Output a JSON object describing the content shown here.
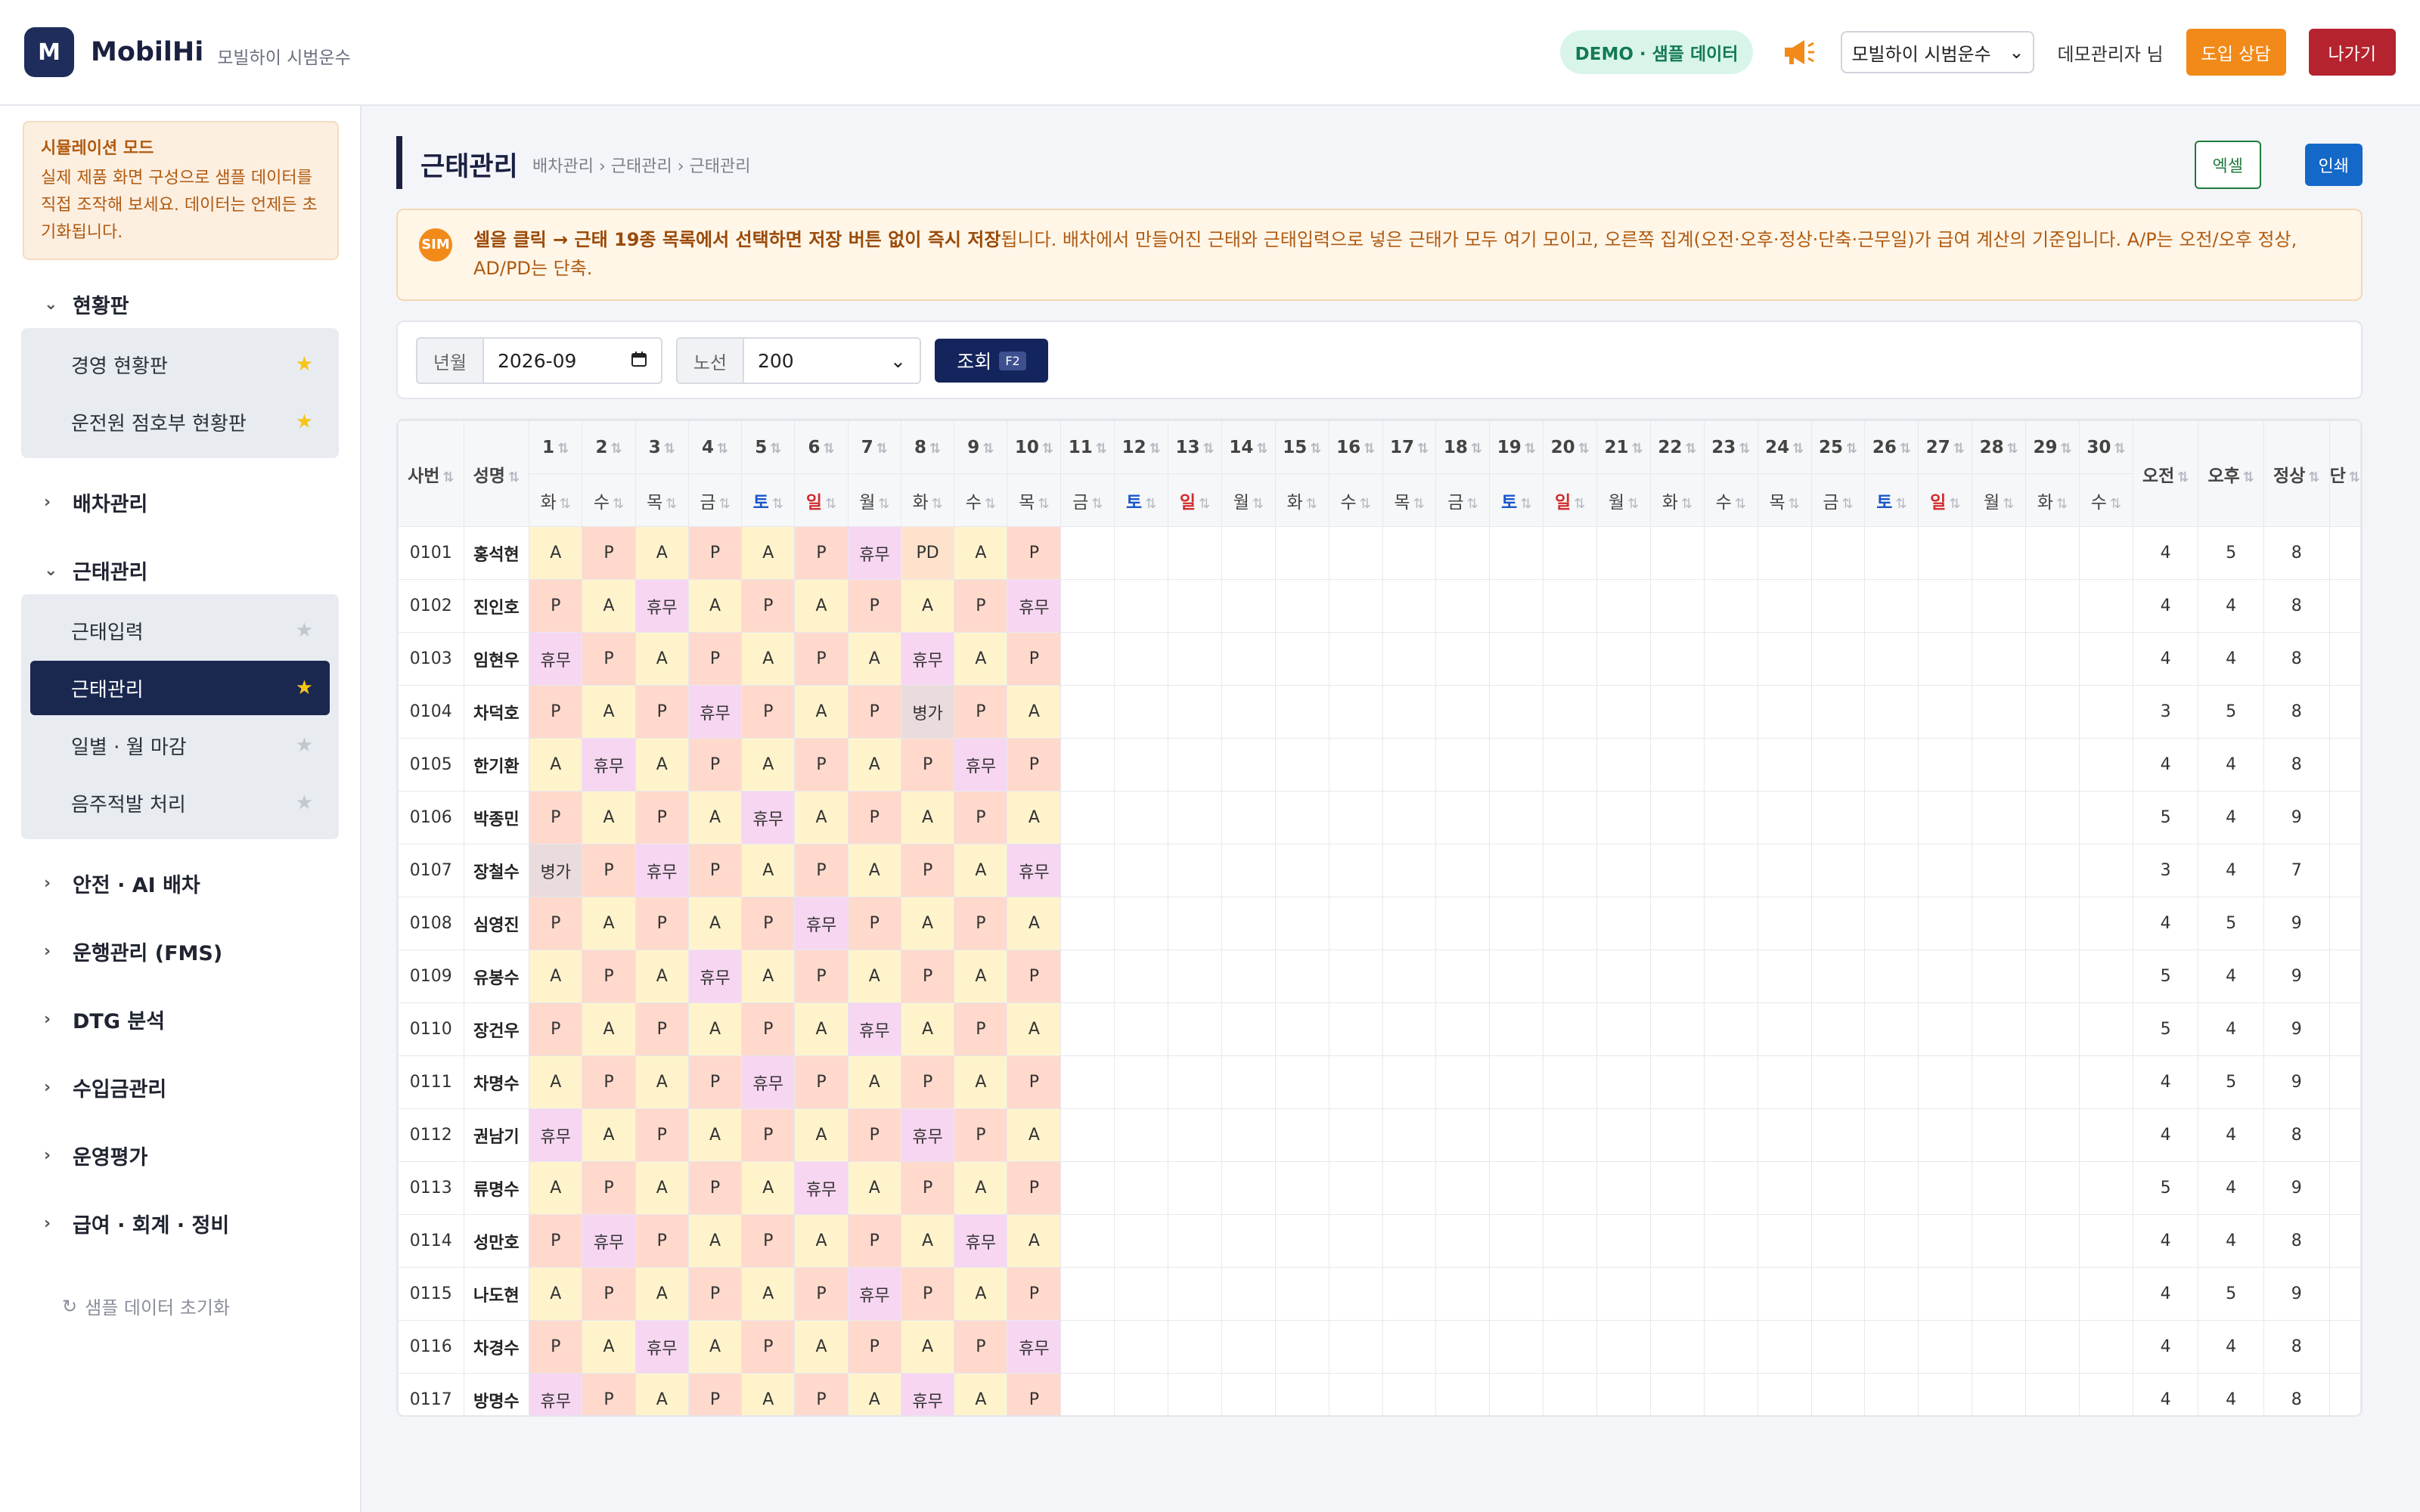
{
  "header": {
    "logo_letter": "M",
    "brand": "MobilHi",
    "brand_sub": "모빌하이 시범운수",
    "demo_badge": "DEMO · 샘플 데이터",
    "org_selected": "모빌하이 시범운수",
    "user": "데모관리자 님",
    "consult_label": "도입 상담",
    "exit_label": "나가기",
    "megaphone_color": "#f28a1a"
  },
  "sidebar": {
    "sim_title": "시뮬레이션 모드",
    "sim_text": "실제 제품 화면 구성으로 샘플 데이터를 직접 조작해 보세요. 데이터는 언제든 초기화됩니다.",
    "groups": [
      {
        "label": "현황판",
        "expanded": true,
        "items": [
          {
            "label": "경영 현황판",
            "starred": true,
            "active": false
          },
          {
            "label": "운전원 점호부 현황판",
            "starred": true,
            "active": false
          }
        ]
      },
      {
        "label": "배차관리",
        "expanded": false,
        "items": []
      },
      {
        "label": "근태관리",
        "expanded": true,
        "items": [
          {
            "label": "근태입력",
            "starred": false,
            "active": false
          },
          {
            "label": "근태관리",
            "starred": true,
            "active": true
          },
          {
            "label": "일별 · 월 마감",
            "starred": false,
            "active": false
          },
          {
            "label": "음주적발 처리",
            "starred": false,
            "active": false
          }
        ]
      },
      {
        "label": "안전 · AI 배차",
        "expanded": false,
        "items": []
      },
      {
        "label": "운행관리 (FMS)",
        "expanded": false,
        "items": []
      },
      {
        "label": "DTG 분석",
        "expanded": false,
        "items": []
      },
      {
        "label": "수입금관리",
        "expanded": false,
        "items": []
      },
      {
        "label": "운영평가",
        "expanded": false,
        "items": []
      },
      {
        "label": "급여 · 회계 · 정비",
        "expanded": false,
        "items": []
      }
    ],
    "reset_label": "샘플 데이터 초기화"
  },
  "page": {
    "title": "근태관리",
    "breadcrumb": "배차관리 › 근태관리 › 근태관리",
    "excel_label": "엑셀",
    "print_label": "인쇄"
  },
  "notice": {
    "icon": "SIM",
    "bold": "셀을 클릭 → 근태 19종 목록에서 선택하면 저장 버튼 없이 즉시 저장",
    "rest": "됩니다. 배차에서 만들어진 근태와 근태입력으로 넣은 근태가 모두 여기 모이고, 오른쪽 집계(오전·오후·정상·단축·근무일)가 급여 계산의 기준입니다. A/P는 오전/오후 정상, AD/PD는 단축."
  },
  "filter": {
    "month_label": "년월",
    "month_value": "2026-09",
    "route_label": "노선",
    "route_value": "200",
    "query_label": "조회",
    "query_key": "F2"
  },
  "grid": {
    "col_emp": "사번",
    "col_name": "성명",
    "days": [
      "1",
      "2",
      "3",
      "4",
      "5",
      "6",
      "7",
      "8",
      "9",
      "10",
      "11",
      "12",
      "13",
      "14",
      "15",
      "16",
      "17",
      "18",
      "19",
      "20",
      "21",
      "22",
      "23",
      "24",
      "25",
      "26",
      "27",
      "28",
      "29",
      "30"
    ],
    "weekdays": [
      "화",
      "수",
      "목",
      "금",
      "토",
      "일",
      "월",
      "화",
      "수",
      "목",
      "금",
      "토",
      "일",
      "월",
      "화",
      "수",
      "목",
      "금",
      "토",
      "일",
      "월",
      "화",
      "수",
      "목",
      "금",
      "토",
      "일",
      "월",
      "화",
      "수"
    ],
    "sum_cols": [
      "오전",
      "오후",
      "정상",
      "단"
    ],
    "rows": [
      {
        "emp": "0101",
        "name": "홍석현",
        "cells": [
          "A",
          "P",
          "A",
          "P",
          "A",
          "P",
          "휴무",
          "PD",
          "A",
          "P"
        ],
        "am": "4",
        "pm": "5",
        "normal": "8"
      },
      {
        "emp": "0102",
        "name": "진인호",
        "cells": [
          "P",
          "A",
          "휴무",
          "A",
          "P",
          "A",
          "P",
          "A",
          "P",
          "휴무"
        ],
        "am": "4",
        "pm": "4",
        "normal": "8"
      },
      {
        "emp": "0103",
        "name": "임현우",
        "cells": [
          "휴무",
          "P",
          "A",
          "P",
          "A",
          "P",
          "A",
          "휴무",
          "A",
          "P"
        ],
        "am": "4",
        "pm": "4",
        "normal": "8"
      },
      {
        "emp": "0104",
        "name": "차덕호",
        "cells": [
          "P",
          "A",
          "P",
          "휴무",
          "P",
          "A",
          "P",
          "병가",
          "P",
          "A"
        ],
        "am": "3",
        "pm": "5",
        "normal": "8"
      },
      {
        "emp": "0105",
        "name": "한기환",
        "cells": [
          "A",
          "휴무",
          "A",
          "P",
          "A",
          "P",
          "A",
          "P",
          "휴무",
          "P"
        ],
        "am": "4",
        "pm": "4",
        "normal": "8"
      },
      {
        "emp": "0106",
        "name": "박종민",
        "cells": [
          "P",
          "A",
          "P",
          "A",
          "휴무",
          "A",
          "P",
          "A",
          "P",
          "A"
        ],
        "am": "5",
        "pm": "4",
        "normal": "9"
      },
      {
        "emp": "0107",
        "name": "장철수",
        "cells": [
          "병가",
          "P",
          "휴무",
          "P",
          "A",
          "P",
          "A",
          "P",
          "A",
          "휴무"
        ],
        "am": "3",
        "pm": "4",
        "normal": "7"
      },
      {
        "emp": "0108",
        "name": "심영진",
        "cells": [
          "P",
          "A",
          "P",
          "A",
          "P",
          "휴무",
          "P",
          "A",
          "P",
          "A"
        ],
        "am": "4",
        "pm": "5",
        "normal": "9"
      },
      {
        "emp": "0109",
        "name": "유봉수",
        "cells": [
          "A",
          "P",
          "A",
          "휴무",
          "A",
          "P",
          "A",
          "P",
          "A",
          "P"
        ],
        "am": "5",
        "pm": "4",
        "normal": "9"
      },
      {
        "emp": "0110",
        "name": "장건우",
        "cells": [
          "P",
          "A",
          "P",
          "A",
          "P",
          "A",
          "휴무",
          "A",
          "P",
          "A"
        ],
        "am": "5",
        "pm": "4",
        "normal": "9"
      },
      {
        "emp": "0111",
        "name": "차명수",
        "cells": [
          "A",
          "P",
          "A",
          "P",
          "휴무",
          "P",
          "A",
          "P",
          "A",
          "P"
        ],
        "am": "4",
        "pm": "5",
        "normal": "9"
      },
      {
        "emp": "0112",
        "name": "권남기",
        "cells": [
          "휴무",
          "A",
          "P",
          "A",
          "P",
          "A",
          "P",
          "휴무",
          "P",
          "A"
        ],
        "am": "4",
        "pm": "4",
        "normal": "8"
      },
      {
        "emp": "0113",
        "name": "류명수",
        "cells": [
          "A",
          "P",
          "A",
          "P",
          "A",
          "휴무",
          "A",
          "P",
          "A",
          "P"
        ],
        "am": "5",
        "pm": "4",
        "normal": "9"
      },
      {
        "emp": "0114",
        "name": "성만호",
        "cells": [
          "P",
          "휴무",
          "P",
          "A",
          "P",
          "A",
          "P",
          "A",
          "휴무",
          "A"
        ],
        "am": "4",
        "pm": "4",
        "normal": "8"
      },
      {
        "emp": "0115",
        "name": "나도현",
        "cells": [
          "A",
          "P",
          "A",
          "P",
          "A",
          "P",
          "휴무",
          "P",
          "A",
          "P"
        ],
        "am": "4",
        "pm": "5",
        "normal": "9"
      },
      {
        "emp": "0116",
        "name": "차경수",
        "cells": [
          "P",
          "A",
          "휴무",
          "A",
          "P",
          "A",
          "P",
          "A",
          "P",
          "휴무"
        ],
        "am": "4",
        "pm": "4",
        "normal": "8"
      },
      {
        "emp": "0117",
        "name": "방명수",
        "cells": [
          "휴무",
          "P",
          "A",
          "P",
          "A",
          "P",
          "A",
          "휴무",
          "A",
          "P"
        ],
        "am": "4",
        "pm": "4",
        "normal": "8"
      }
    ]
  }
}
